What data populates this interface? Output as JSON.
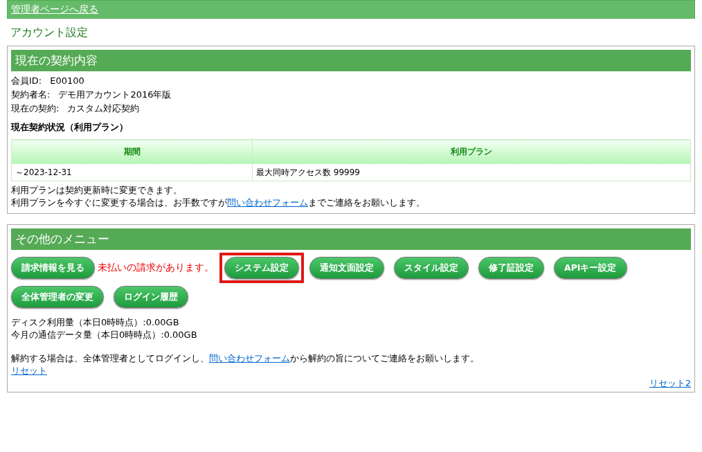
{
  "top_bar": {
    "back_link": "管理者ページへ戻る"
  },
  "page_title": "アカウント設定",
  "contract": {
    "heading": "現在の契約内容",
    "fields": [
      {
        "label": "会員ID:",
        "value": "E00100"
      },
      {
        "label": "契約者名:",
        "value": "デモ用アカウント2016年版"
      },
      {
        "label": "現在の契約:",
        "value": "カスタム対応契約"
      }
    ],
    "status_heading": "現在契約状況（利用プラン）",
    "table": {
      "columns": [
        "期間",
        "利用プラン"
      ],
      "rows": [
        [
          "～2023-12-31",
          "最大同時アクセス数 99999"
        ]
      ]
    },
    "note_1": "利用プランは契約更新時に変更できます。",
    "note_2": {
      "before": "利用プランを今すぐに変更する場合は、お手数ですが",
      "link": "問い合わせフォーム",
      "after": "までご連絡をお願いします。"
    }
  },
  "other_menu": {
    "heading": "その他のメニュー",
    "billing_button": "請求情報を見る",
    "unpaid_notice": "未払いの請求があります。",
    "buttons": [
      {
        "label": "システム設定",
        "highlighted": true
      },
      {
        "label": "通知文面設定",
        "highlighted": false
      },
      {
        "label": "スタイル設定",
        "highlighted": false
      },
      {
        "label": "修了証設定",
        "highlighted": false
      },
      {
        "label": "APIキー設定",
        "highlighted": false
      },
      {
        "label": "全体管理者の変更",
        "highlighted": false
      },
      {
        "label": "ログイン履歴",
        "highlighted": false
      }
    ],
    "disk_usage": "ディスク利用量（本日0時時点）:0.00GB",
    "traffic": "今月の通信データ量（本日0時時点）:0.00GB",
    "cancel_note": {
      "before": "解約する場合は、全体管理者としてログインし、",
      "link": "問い合わせフォーム",
      "after": "から解約の旨についてご連絡をお願いします。"
    },
    "reset_link": "リセット",
    "reset2_link": "リセット2"
  }
}
